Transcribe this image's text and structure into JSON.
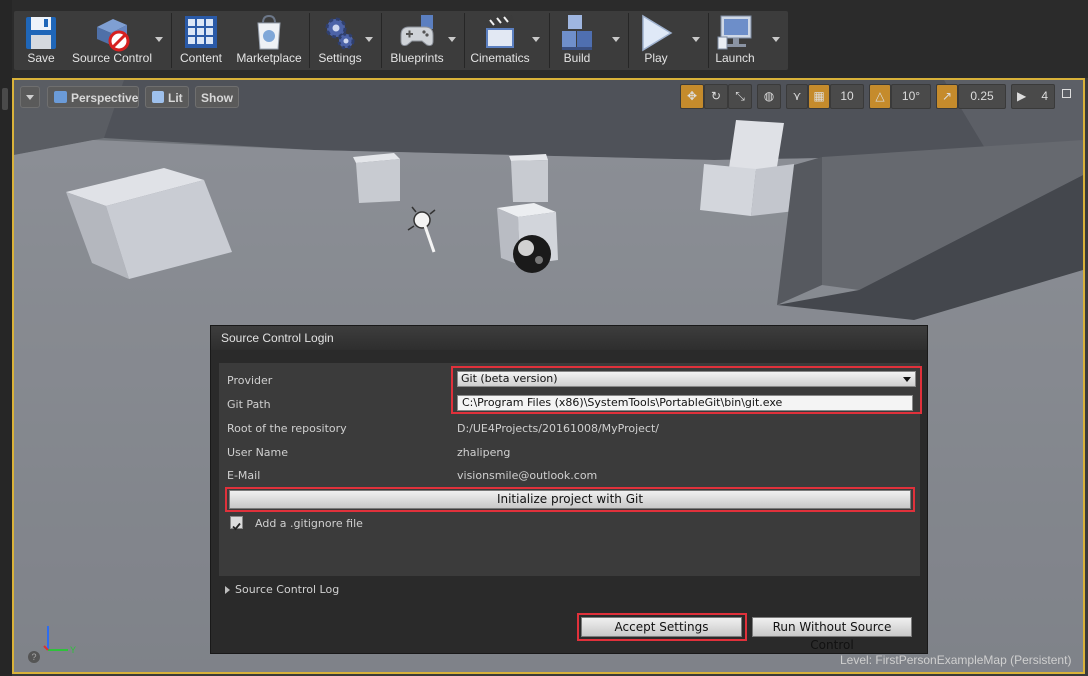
{
  "toolbar": {
    "save": "Save",
    "source_control": "Source Control",
    "content": "Content",
    "marketplace": "Marketplace",
    "settings": "Settings",
    "blueprints": "Blueprints",
    "cinematics": "Cinematics",
    "build": "Build",
    "play": "Play",
    "launch": "Launch"
  },
  "viewport": {
    "perspective": "Perspective",
    "lit": "Lit",
    "show": "Show",
    "grid_snap": "10",
    "rotation_snap": "10°",
    "scale_snap": "0.25",
    "camera_speed": "4",
    "axis_y": "Y",
    "help_glyph": "?",
    "level_label": "Level:",
    "level_name": "FirstPersonExampleMap (Persistent)"
  },
  "dialog": {
    "title": "Source Control Login",
    "provider_label": "Provider",
    "provider_value": "Git  (beta version)",
    "git_path_label": "Git Path",
    "git_path_value": "C:\\Program Files (x86)\\SystemTools\\PortableGit\\bin\\git.exe",
    "repo_root_label": "Root of the repository",
    "repo_root_value": "D:/UE4Projects/20161008/MyProject/",
    "user_name_label": "User Name",
    "user_name_value": "zhalipeng",
    "email_label": "E-Mail",
    "email_value": "visionsmile@outlook.com",
    "init_button": "Initialize project with Git",
    "gitignore_label": "Add a .gitignore file",
    "log_label": "Source Control Log",
    "accept_button": "Accept Settings",
    "run_without_button": "Run Without Source Control"
  },
  "colors": {
    "highlight_border": "#e0313b",
    "viewport_border": "#d9b23a",
    "snap_active": "#c58b2c"
  }
}
